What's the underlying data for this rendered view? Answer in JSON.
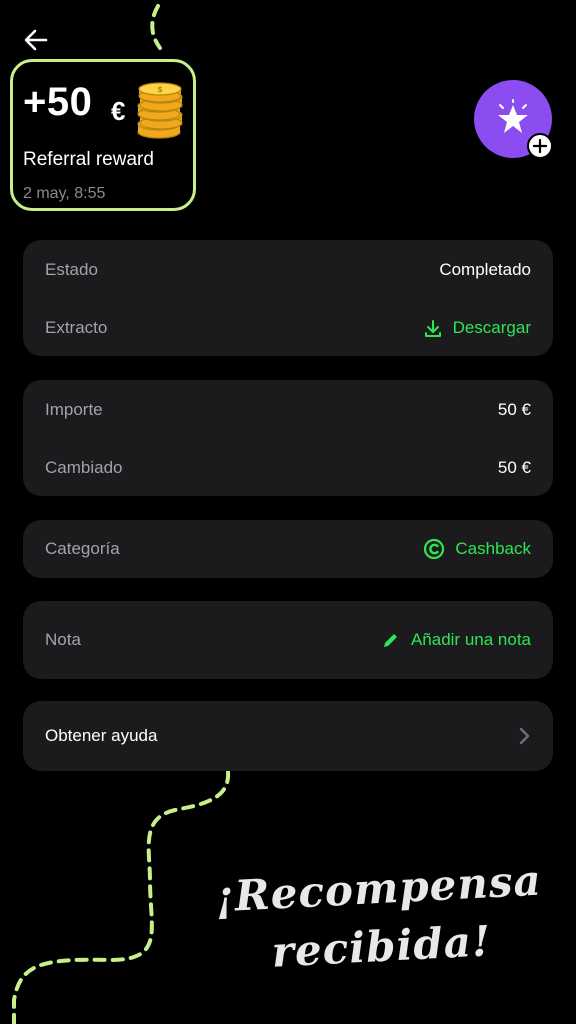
{
  "reward": {
    "amount": "+50",
    "currency": "€",
    "title": "Referral reward",
    "date": "2 may, 8:55",
    "border_color": "#c8f08a"
  },
  "status_card": {
    "estado_label": "Estado",
    "estado_value": "Completado",
    "extracto_label": "Extracto",
    "extracto_action": "Descargar"
  },
  "amount_card": {
    "importe_label": "Importe",
    "importe_value": "50 €",
    "cambiado_label": "Cambiado",
    "cambiado_value": "50 €"
  },
  "category_card": {
    "label": "Categoría",
    "value": "Cashback"
  },
  "note_card": {
    "label": "Nota",
    "action": "Añadir una nota"
  },
  "help_card": {
    "label": "Obtener ayuda"
  },
  "slogan": {
    "line1": "¡Recompensa",
    "line2": "recibida!"
  },
  "icons": {
    "back": "arrow-left-icon",
    "coins": "coin-stack-icon",
    "avatar": "star-icon",
    "avatar_add": "plus-icon",
    "download": "download-icon",
    "cashback": "cashback-icon",
    "note": "pencil-icon",
    "help": "chevron-right-icon"
  },
  "colors": {
    "background": "#000000",
    "card": "#1b1b1d",
    "accent_green": "#2ee553",
    "avatar_purple": "#8b4cf0",
    "dash_lime": "#c8f08a"
  }
}
